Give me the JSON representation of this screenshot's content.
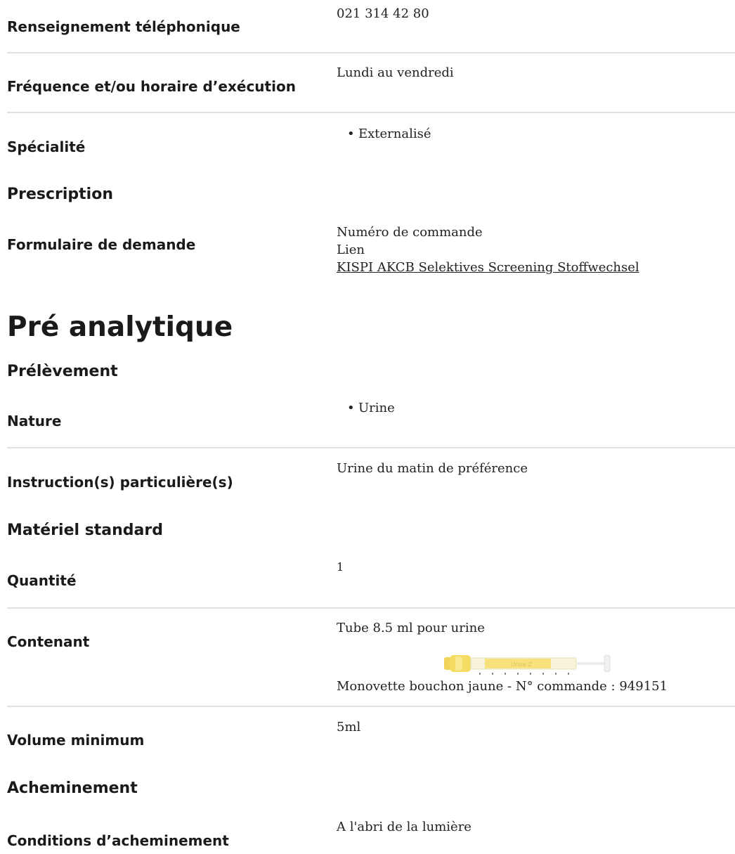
{
  "rows": {
    "phone": {
      "label": "Renseignement téléphonique",
      "value": "021 314 42 80"
    },
    "frequency": {
      "label": "Fréquence et/ou horaire d’exécution",
      "value": "Lundi au vendredi"
    },
    "specialty": {
      "label": "Spécialité",
      "items": [
        "Externalisé"
      ]
    }
  },
  "prescription": {
    "title": "Prescription",
    "form_label": "Formulaire de demande",
    "order_number_label": "Numéro de commande",
    "link_label": "Lien",
    "link_text": "KISPI AKCB Selektives Screening Stoffwechsel"
  },
  "preanalytic": {
    "title": "Pré analytique",
    "sampling": {
      "title": "Prélèvement",
      "nature_label": "Nature",
      "nature_items": [
        "Urine"
      ],
      "instructions_label": "Instruction(s) particulière(s)",
      "instructions_value": "Urine du matin de préférence"
    },
    "material": {
      "title": "Matériel standard",
      "quantity_label": "Quantité",
      "quantity_value": "1",
      "container_label": "Contenant",
      "container_value": "Tube 8.5 ml pour urine",
      "container_image_text": "Urine Z",
      "container_caption": "Monovette bouchon jaune - N° commande : 949151",
      "volume_label": "Volume minimum",
      "volume_value": "5ml"
    },
    "transport": {
      "title": "Acheminement",
      "conditions_label": "Conditions d’acheminement",
      "conditions_value": "A l'abri de la lumière"
    }
  },
  "colors": {
    "divider": "#e2e2e2",
    "tube_cap": "#f2d64a",
    "tube_label": "#f7e27a"
  },
  "icons": {
    "tube": "urine-monovette-tube"
  }
}
